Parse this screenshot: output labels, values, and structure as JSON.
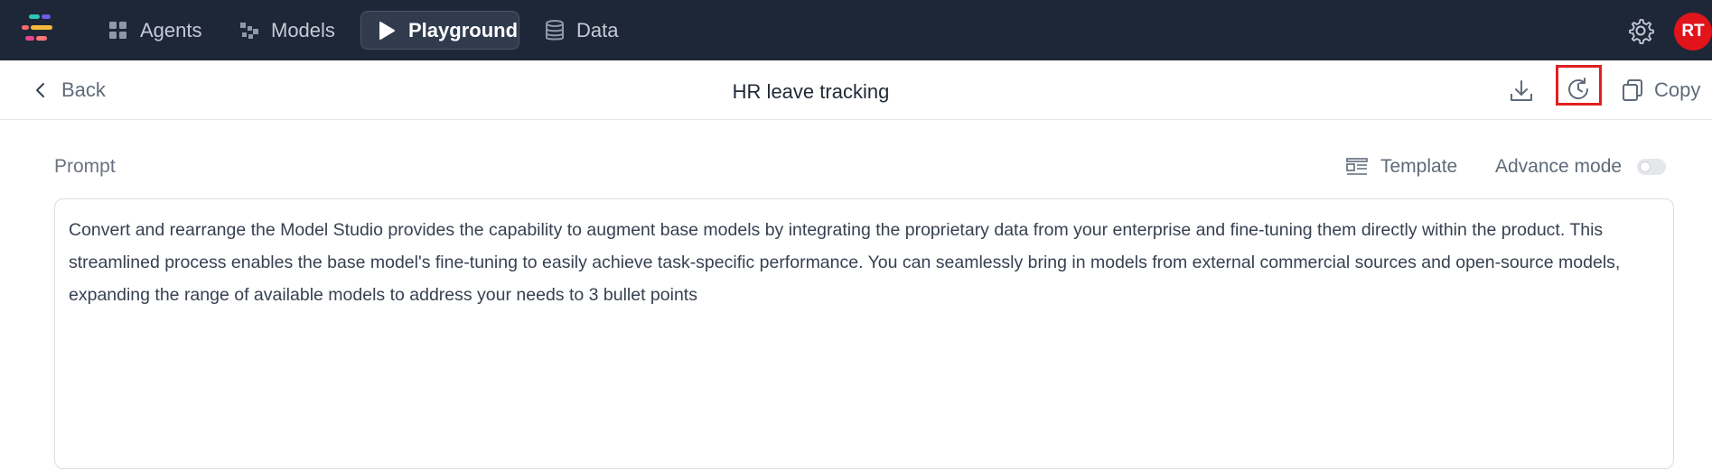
{
  "nav": {
    "items": [
      {
        "label": "Agents",
        "icon": "grid-icon"
      },
      {
        "label": "Models",
        "icon": "models-icon"
      },
      {
        "label": "Playground",
        "icon": "play-icon",
        "active": true
      },
      {
        "label": "Data",
        "icon": "database-icon"
      }
    ],
    "user_initials": "RT"
  },
  "subheader": {
    "back_label": "Back",
    "title": "HR leave tracking",
    "copy_label": "Copy"
  },
  "prompt": {
    "label": "Prompt",
    "template_label": "Template",
    "advance_mode_label": "Advance mode",
    "advance_mode_on": false,
    "text": "Convert and rearrange the Model Studio provides the capability to augment base models by integrating the proprietary data from your enterprise and fine-tuning them directly within the product. This streamlined process enables the base model's fine-tuning to easily achieve task-specific performance. You can seamlessly bring in models from external commercial sources and open-source models, expanding the range of available models to address your needs to 3 bullet points"
  },
  "colors": {
    "topbar_bg": "#1e2738",
    "highlight_box": "#e02020",
    "avatar_bg": "#e2141b"
  }
}
